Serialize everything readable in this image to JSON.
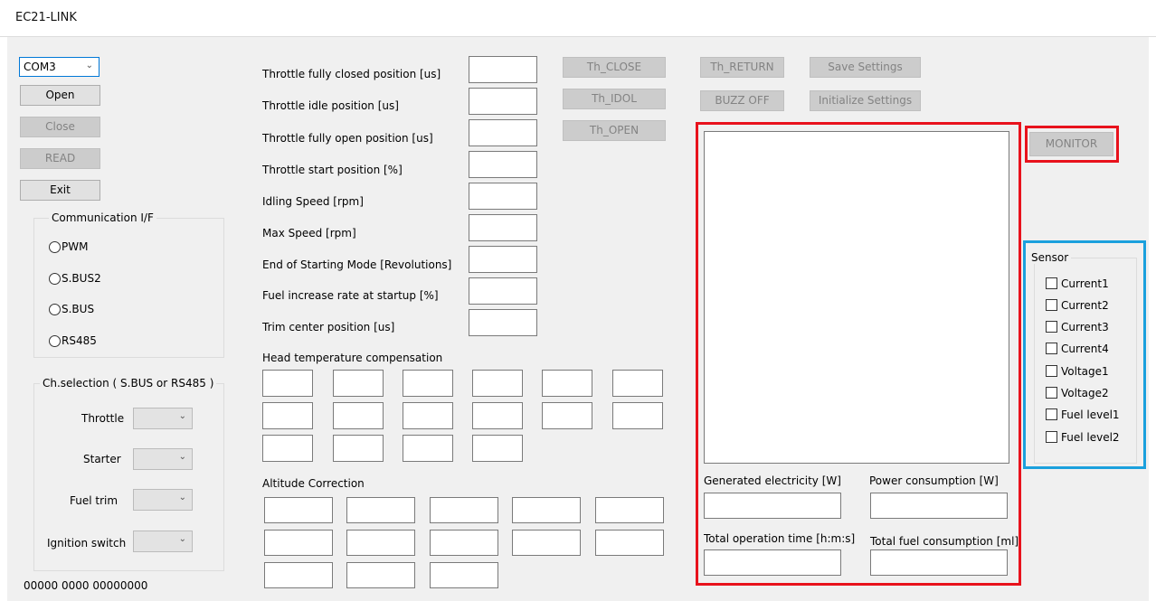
{
  "window": {
    "title": "EC21-LINK"
  },
  "port": {
    "value": "COM3"
  },
  "left_buttons": {
    "open": "Open",
    "close": "Close",
    "read": "READ",
    "exit": "Exit"
  },
  "comm": {
    "title": "Communication I/F",
    "options": [
      "PWM",
      "S.BUS2",
      "S.BUS",
      "RS485"
    ]
  },
  "ch": {
    "title": "Ch.selection ( S.BUS or RS485 )",
    "throttle": "Throttle",
    "starter": "Starter",
    "fuel_trim": "Fuel trim",
    "ignition": "Ignition switch"
  },
  "status": "00000  0000  00000000",
  "params": [
    "Throttle fully closed position [us]",
    "Throttle idle position [us]",
    "Throttle fully open position [us]",
    "Throttle start position [%]",
    "Idling Speed [rpm]",
    "Max Speed [rpm]",
    "End of Starting Mode [Revolutions]",
    "Fuel increase rate at startup [%]",
    "Trim center position [us]"
  ],
  "th_buttons": {
    "close": "Th_CLOSE",
    "idol": "Th_IDOL",
    "open": "Th_OPEN"
  },
  "top_buttons": {
    "ret": "Th_RETURN",
    "buzz": "BUZZ OFF",
    "save": "Save Settings",
    "init": "Initialize Settings"
  },
  "head_temp": {
    "label": "Head temperature compensation"
  },
  "altitude": {
    "label": "Altitude Correction"
  },
  "monitor": {
    "button": "MONITOR",
    "generated": "Generated electricity [W]",
    "power": "Power consumption [W]",
    "time": "Total operation time [h:m:s]",
    "fuel": "Total fuel consumption [ml]"
  },
  "sensor": {
    "title": "Sensor",
    "items": [
      "Current1",
      "Current2",
      "Current3",
      "Current4",
      "Voltage1",
      "Voltage2",
      "Fuel level1",
      "Fuel level2"
    ]
  },
  "colors": {
    "highlight_red": "#e8121c",
    "highlight_blue": "#1ba0dd"
  }
}
